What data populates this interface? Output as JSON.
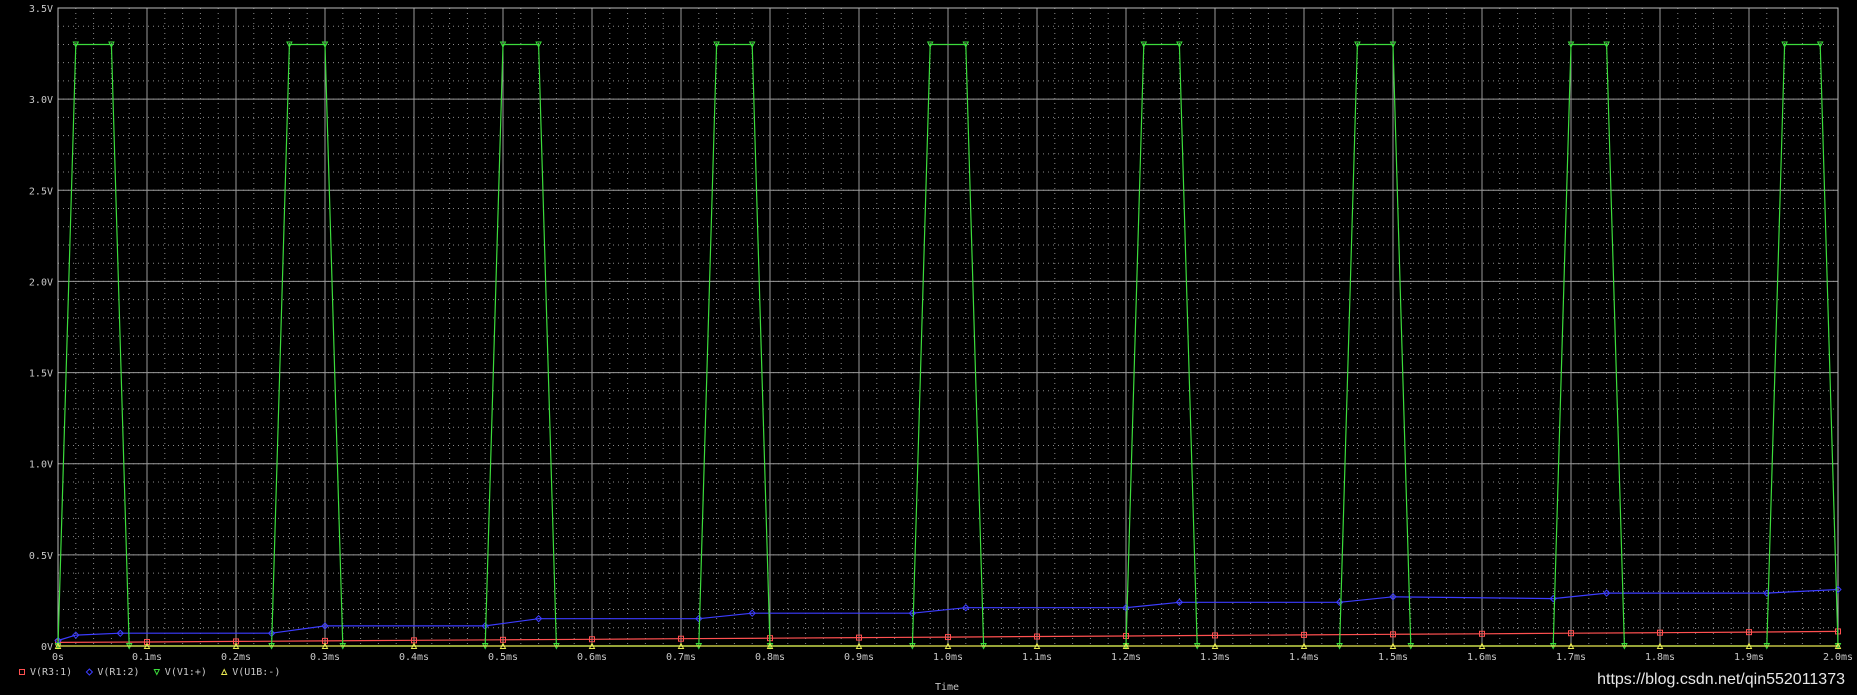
{
  "chart_data": {
    "type": "line",
    "title": "",
    "xlabel": "Time",
    "ylabel": "",
    "x_unit": "ms",
    "xlim": [
      0,
      2.0
    ],
    "ylim": [
      0,
      3.5
    ],
    "x_ticks": [
      0,
      0.1,
      0.2,
      0.3,
      0.4,
      0.5,
      0.6,
      0.7,
      0.8,
      0.9,
      1.0,
      1.1,
      1.2,
      1.3,
      1.4,
      1.5,
      1.6,
      1.7,
      1.8,
      1.9,
      2.0
    ],
    "x_tick_labels": [
      "0s",
      "0.1ms",
      "0.2ms",
      "0.3ms",
      "0.4ms",
      "0.5ms",
      "0.6ms",
      "0.7ms",
      "0.8ms",
      "0.9ms",
      "1.0ms",
      "1.1ms",
      "1.2ms",
      "1.3ms",
      "1.4ms",
      "1.5ms",
      "1.6ms",
      "1.7ms",
      "1.8ms",
      "1.9ms",
      "2.0ms"
    ],
    "y_ticks": [
      0,
      0.5,
      1.0,
      1.5,
      2.0,
      2.5,
      3.0,
      3.5
    ],
    "y_tick_labels": [
      "0V",
      "0.5V",
      "1.0V",
      "1.5V",
      "2.0V",
      "2.5V",
      "3.0V",
      "3.5V"
    ],
    "grid": true,
    "legend_position": "bottom-left",
    "series": [
      {
        "name": "V(R3:1)",
        "color": "#ff5050",
        "marker": "square",
        "x": [
          0,
          0.1,
          0.2,
          0.3,
          0.4,
          0.5,
          0.6,
          0.7,
          0.8,
          0.9,
          1.0,
          1.1,
          1.2,
          1.3,
          1.4,
          1.5,
          1.6,
          1.7,
          1.8,
          1.9,
          2.0
        ],
        "y": [
          0.02,
          0.022,
          0.025,
          0.028,
          0.031,
          0.034,
          0.037,
          0.04,
          0.043,
          0.046,
          0.049,
          0.052,
          0.055,
          0.058,
          0.061,
          0.064,
          0.067,
          0.07,
          0.073,
          0.076,
          0.08
        ]
      },
      {
        "name": "V(R1:2)",
        "color": "#3c3cff",
        "marker": "diamond",
        "x": [
          0,
          0.02,
          0.07,
          0.24,
          0.3,
          0.48,
          0.54,
          0.72,
          0.78,
          0.96,
          1.02,
          1.2,
          1.26,
          1.44,
          1.5,
          1.68,
          1.74,
          1.92,
          2.0
        ],
        "y": [
          0.03,
          0.06,
          0.07,
          0.07,
          0.11,
          0.11,
          0.15,
          0.15,
          0.18,
          0.18,
          0.21,
          0.21,
          0.24,
          0.24,
          0.27,
          0.26,
          0.29,
          0.29,
          0.31
        ]
      },
      {
        "name": "V(V1:+)",
        "color": "#3cdc3c",
        "marker": "triangle-down",
        "x": [
          0.0,
          0.02,
          0.06,
          0.08,
          0.24,
          0.26,
          0.3,
          0.32,
          0.48,
          0.5,
          0.54,
          0.56,
          0.72,
          0.74,
          0.78,
          0.8,
          0.96,
          0.98,
          1.02,
          1.04,
          1.2,
          1.22,
          1.26,
          1.28,
          1.44,
          1.46,
          1.5,
          1.52,
          1.68,
          1.7,
          1.74,
          1.76,
          1.92,
          1.94,
          1.98,
          2.0
        ],
        "y": [
          0,
          3.3,
          3.3,
          0,
          0,
          3.3,
          3.3,
          0,
          0,
          3.3,
          3.3,
          0,
          0,
          3.3,
          3.3,
          0,
          0,
          3.3,
          3.3,
          0,
          0,
          3.3,
          3.3,
          0,
          0,
          3.3,
          3.3,
          0,
          0,
          3.3,
          3.3,
          0,
          0,
          3.3,
          3.3,
          0
        ]
      },
      {
        "name": "V(U1B:-)",
        "color": "#e6e650",
        "marker": "triangle-up",
        "x": [
          0,
          0.1,
          0.2,
          0.3,
          0.4,
          0.5,
          0.6,
          0.7,
          0.8,
          0.9,
          1.0,
          1.1,
          1.2,
          1.3,
          1.4,
          1.5,
          1.6,
          1.7,
          1.8,
          1.9,
          2.0
        ],
        "y": [
          0.0,
          0.0,
          0.0,
          0.0,
          0.0,
          0.0,
          0.0,
          0.0,
          0.0,
          0.0,
          0.0,
          0.0,
          0.0,
          0.0,
          0.0,
          0.0,
          0.0,
          0.0,
          0.0,
          0.0,
          0.0
        ]
      }
    ]
  },
  "watermark": "https://blog.csdn.net/qin552011373"
}
